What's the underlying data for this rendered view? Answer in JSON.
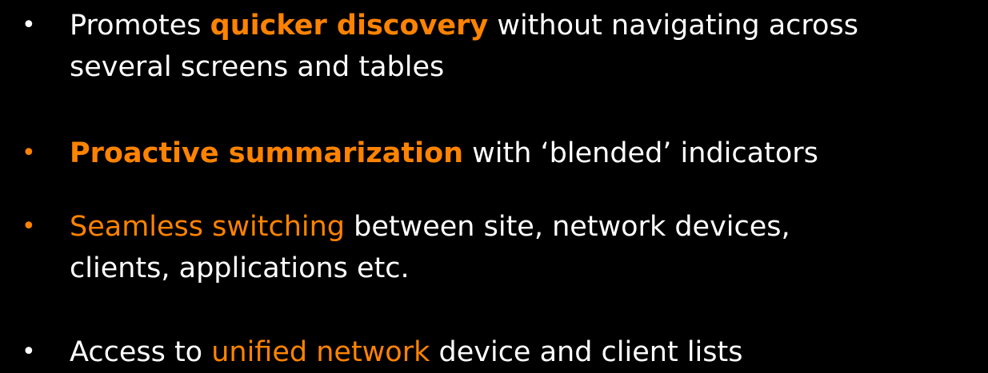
{
  "bullets": {
    "item1": {
      "line1_pre": "Promotes ",
      "line1_emph": "quicker discovery",
      "line1_post": " without navigating across",
      "line2": "several screens and tables"
    },
    "item2": {
      "emph": "Proactive summarization",
      "post": " with ‘blended’ indicators"
    },
    "item3": {
      "highlight": "Seamless switching",
      "line1_post": " between site, network devices,",
      "line2": "clients, applications etc."
    },
    "item4": {
      "pre": "Access to ",
      "highlight": "unified network",
      "post": " device and client lists"
    }
  },
  "bullet_glyph": "•",
  "colors": {
    "background": "#000000",
    "text": "#ffffff",
    "accent": "#ff8300"
  }
}
